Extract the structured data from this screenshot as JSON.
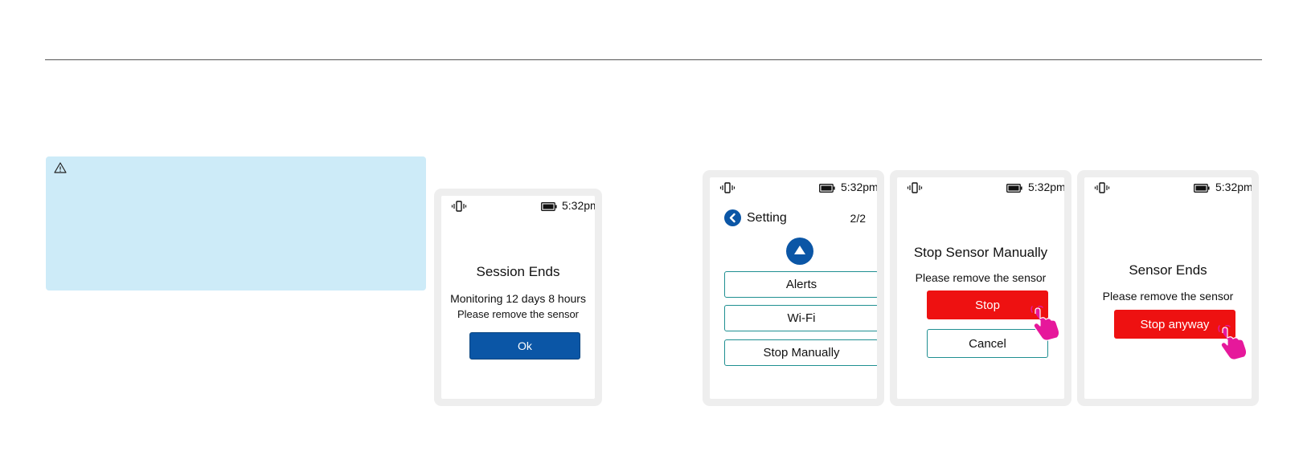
{
  "colors": {
    "info_box_bg": "#cdebf8",
    "device_frame": "#eeeeee",
    "primary_blue": "#0b56a6",
    "danger_red": "#ee1111",
    "outline_teal": "#1f8f91",
    "hand_pointer": "#e6189b"
  },
  "icons": [
    "warning-icon",
    "vibrate-icon",
    "battery-icon",
    "back-chevron-icon",
    "scroll-up-icon",
    "hand-pointer-icon"
  ],
  "screens": [
    {
      "time": "5:32pm",
      "title": "Session Ends",
      "line1": "Monitoring  12 days 8 hours",
      "line2": "Please remove the sensor",
      "button": "Ok"
    },
    {
      "time": "5:32pm",
      "header": "Setting",
      "page": "2/2",
      "items": [
        "Alerts",
        "Wi-Fi",
        "Stop Manually"
      ]
    },
    {
      "time": "5:32pm",
      "title": "Stop Sensor Manually",
      "line1": "Please remove the sensor",
      "primary_button": "Stop",
      "secondary_button": "Cancel"
    },
    {
      "time": "5:32pm",
      "title": "Sensor Ends",
      "line1": "Please remove the sensor",
      "button": "Stop anyway"
    }
  ]
}
